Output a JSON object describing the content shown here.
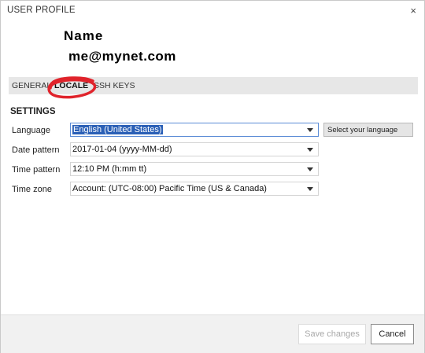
{
  "window": {
    "title": "USER PROFILE",
    "close_glyph": "×"
  },
  "profile": {
    "name": "Name",
    "email": "me@mynet.com"
  },
  "tabs": [
    {
      "label": "GENERAL",
      "active": false
    },
    {
      "label": "LOCALE",
      "active": true
    },
    {
      "label": "SSH KEYS",
      "active": false
    }
  ],
  "annotation": {
    "color": "#e0232b",
    "shape": "hand-drawn-circle"
  },
  "settings": {
    "title": "SETTINGS",
    "rows": [
      {
        "label": "Language",
        "value": "English (United States)"
      },
      {
        "label": "Date pattern",
        "value": "2017-01-04 (yyyy-MM-dd)"
      },
      {
        "label": "Time pattern",
        "value": "12:10 PM (h:mm tt)"
      },
      {
        "label": "Time zone",
        "value": "Account: (UTC-08:00) Pacific Time (US & Canada)"
      }
    ],
    "select_language_button": "Select your language"
  },
  "footer": {
    "save_label": "Save changes",
    "cancel_label": "Cancel"
  },
  "colors": {
    "selection": "#2a5fb6",
    "tab_bar": "#e7e7e7"
  },
  "icons": [
    "close-icon",
    "chevron-down-icon"
  ]
}
